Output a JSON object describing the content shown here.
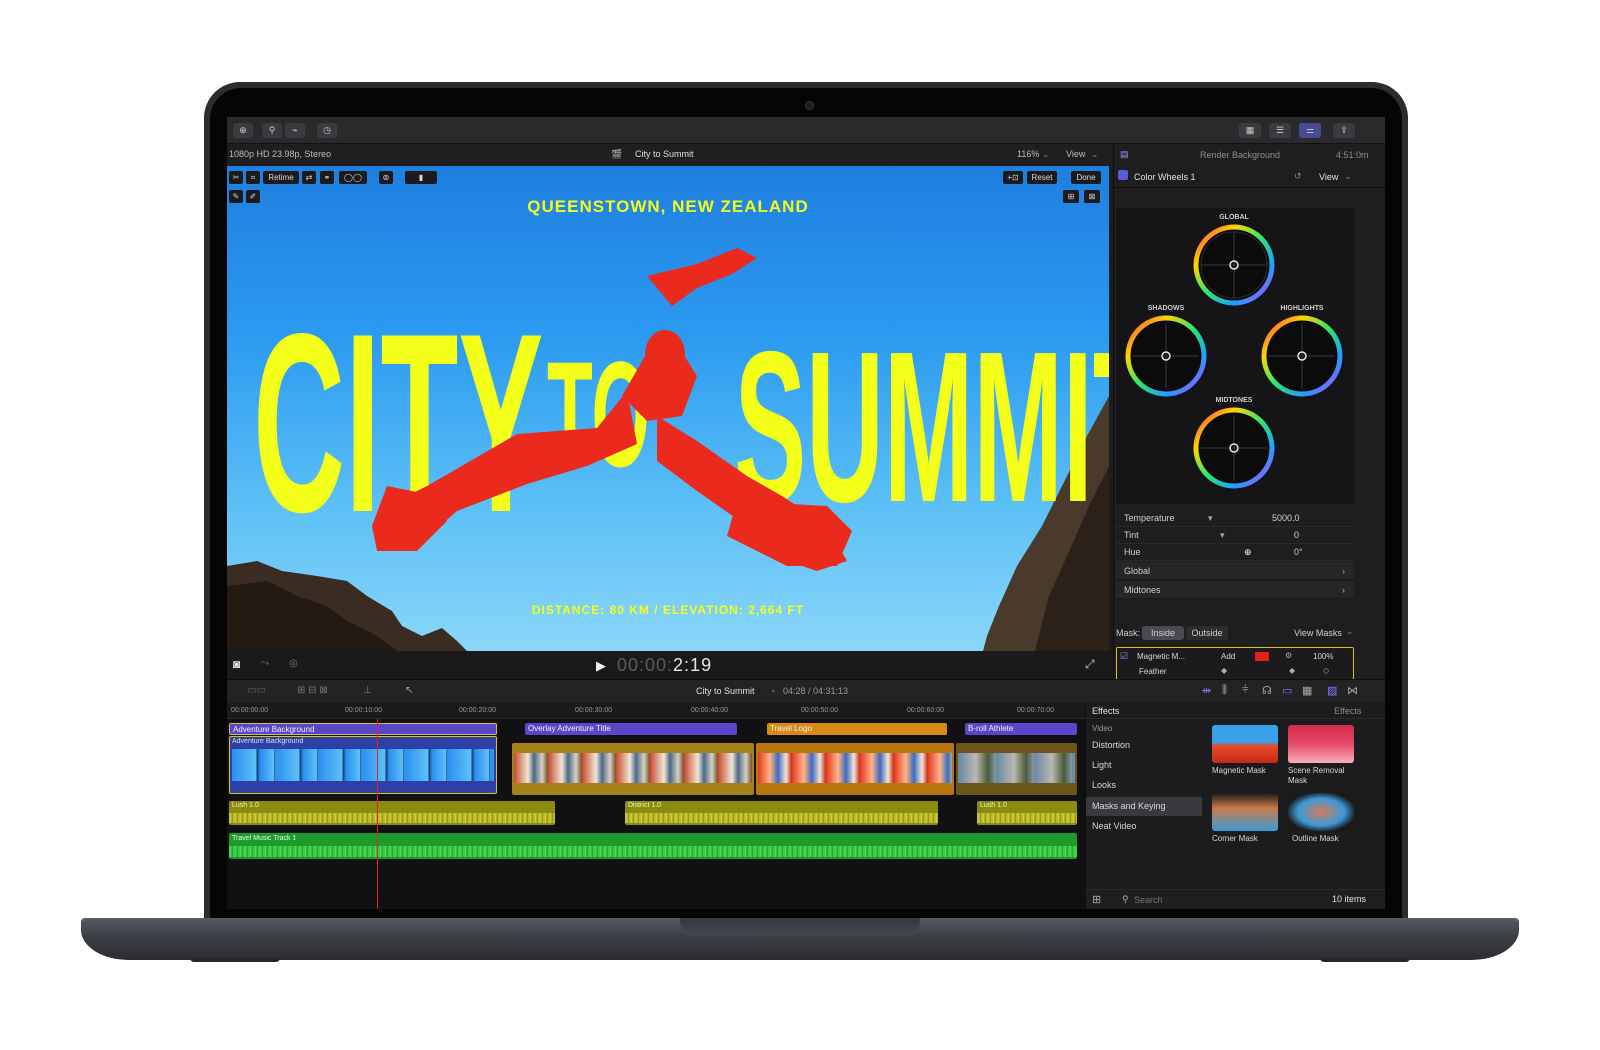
{
  "toolbar": {
    "format_info": "1080p HD 23.98p, Stereo",
    "project_title": "City to Summit",
    "zoom": "116%",
    "view_label": "View",
    "retime_label": "Retime",
    "reset_label": "Reset",
    "done_label": "Done"
  },
  "inspector": {
    "render_status": "Render Background",
    "render_time": "4:51:0m",
    "effect_name": "Color Wheels 1",
    "view_label": "View",
    "wheels": {
      "global": "GLOBAL",
      "shadows": "SHADOWS",
      "highlights": "HIGHLIGHTS",
      "midtones": "MIDTONES"
    },
    "params": [
      {
        "name": "Temperature",
        "value": "5000.0"
      },
      {
        "name": "Tint",
        "value": "0"
      },
      {
        "name": "Hue",
        "value": "0°"
      }
    ],
    "sections": [
      "Global",
      "Midtones"
    ],
    "mask": {
      "label": "Mask:",
      "inside": "Inside",
      "outside": "Outside",
      "view_masks": "View Masks",
      "mask_name": "Magnetic M...",
      "add_label": "Add",
      "percent": "100%",
      "feather_label": "Feather",
      "color": "#e61e1e"
    }
  },
  "viewer": {
    "top_headline": "QUEENSTOWN, NEW ZEALAND",
    "title_word_1": "CITY",
    "title_word_2": "TO",
    "title_word_3": "SUMMIT",
    "bottom_headline": "DISTANCE: 80 KM / ELEVATION: 2,664 FT",
    "timecode_dim": "00:00:",
    "timecode_bright": "2:19",
    "title_color": "#f4ff1a",
    "subject_color": "#ea2a1c"
  },
  "timeline": {
    "project": "City to Summit",
    "position": "04:28 / 04:31:13",
    "ruler": [
      "00:00:00:00",
      "00:00:10:00",
      "00:00:20:00",
      "00:00:30:00",
      "00:00:40:00",
      "00:00:50:00",
      "00:00:60:00",
      "00:00:70:00"
    ],
    "clips": {
      "adventure_bg": "Adventure Background",
      "adventure_sub": "Adventure Background",
      "overlay_title": "Overlay Adventure Title",
      "travel_logo": "Travel Logo",
      "broll": "B-roll Athlete",
      "lush_1": "Lush 1.0",
      "district": "District 1.0",
      "lush_2": "Lush 1.0",
      "music": "Travel Music Track 1"
    }
  },
  "effects": {
    "header": "Effects",
    "header_right": "Effects",
    "categories": [
      "Video",
      "Distortion",
      "Light",
      "Looks",
      "Masks and Keying",
      "Neat Video"
    ],
    "items": [
      "Magnetic Mask",
      "Scene Removal Mask",
      "Corner Mask",
      "Outline Mask"
    ],
    "search_placeholder": "Search",
    "count": "10 items"
  }
}
